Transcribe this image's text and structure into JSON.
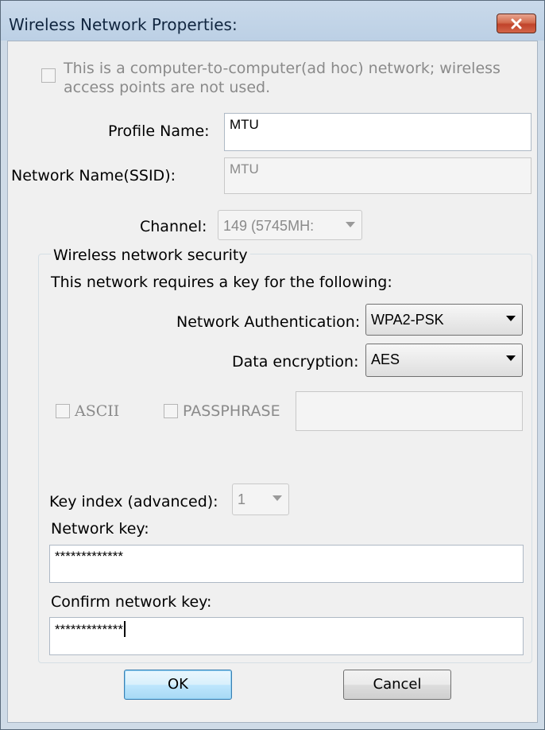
{
  "window": {
    "title": "Wireless Network Properties:"
  },
  "adhoc": {
    "label_line1": "This is a computer-to-computer(ad hoc) network; wireless",
    "label_line2": "access points are not used.",
    "checked": false
  },
  "profile_name": {
    "label": "Profile Name:",
    "value": "MTU"
  },
  "ssid": {
    "label": "Network Name(SSID):",
    "value": "MTU"
  },
  "channel": {
    "label": "Channel:",
    "value": "149 (5745MH:"
  },
  "security": {
    "group_label": "Wireless network security",
    "requires_key_text": "This network requires a key for the following:",
    "auth": {
      "label": "Network Authentication:",
      "value": "WPA2-PSK"
    },
    "encryption": {
      "label": "Data encryption:",
      "value": "AES"
    },
    "ascii_label": "ASCII",
    "passphrase_label": "PASSPHRASE",
    "passphrase_value": "",
    "key_index": {
      "label": "Key index (advanced):",
      "value": "1"
    },
    "network_key": {
      "label": "Network key:",
      "value": "*************"
    },
    "confirm_key": {
      "label": "Confirm network key:",
      "value": "*************"
    }
  },
  "buttons": {
    "ok": "OK",
    "cancel": "Cancel"
  }
}
